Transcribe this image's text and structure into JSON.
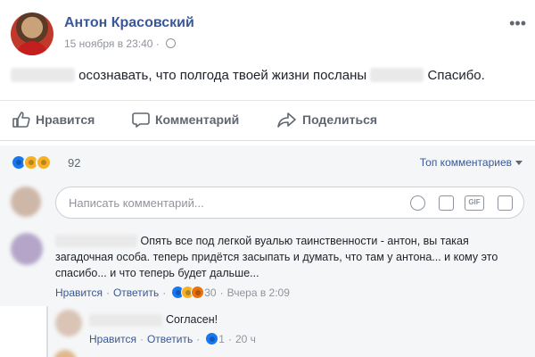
{
  "post": {
    "author": "Антон Красовский",
    "date": "15 ноября в 23:40",
    "text_middle": "осознавать, что полгода твоей жизни посланы",
    "text_end": "Спасибо."
  },
  "actions": {
    "like_label": "Нравится",
    "comment_label": "Комментарий",
    "share_label": "Поделиться"
  },
  "reactions": {
    "icons": [
      "like-reaction",
      "sad-reaction",
      "wow-reaction"
    ],
    "count": "92",
    "sort_label": "Топ комментариев"
  },
  "composer": {
    "placeholder": "Написать комментарий..."
  },
  "comment": {
    "text": "Опять все под легкой вуалью таинственности - антон, вы такая загадочная особа. теперь придётся засыпать и думать, что там у антона... и кому это спасибо... и что теперь будет дальше...",
    "like_label": "Нравится",
    "reply_label": "Ответить",
    "reactions_count": "30",
    "time": "Вчера в 2:09"
  },
  "reply": {
    "text": "Согласен!",
    "like_label": "Нравится",
    "reply_label": "Ответить",
    "reactions_count": "1",
    "time": "20 ч"
  },
  "colors": {
    "link": "#385898",
    "muted": "#90949c",
    "like_blue": "#1877f2",
    "panel": "#f5f6f7"
  }
}
